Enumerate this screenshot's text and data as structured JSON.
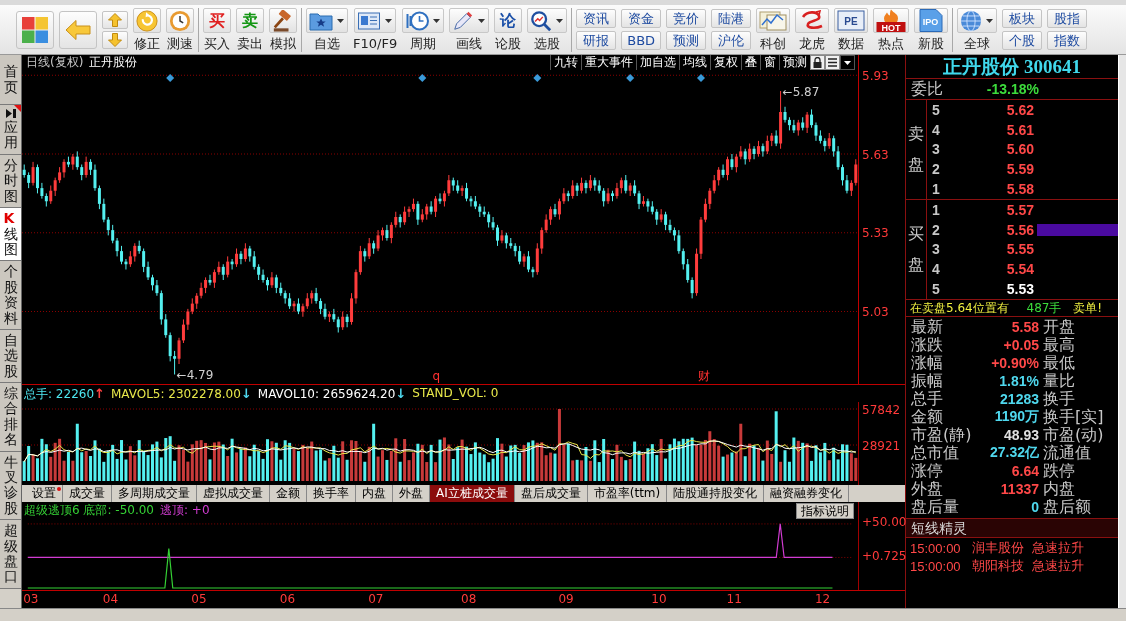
{
  "toolbar": [
    {
      "items": [
        {
          "kind": "launcher"
        },
        {
          "kind": "back"
        },
        {
          "kind": "updown"
        },
        {
          "kind": "tool",
          "label": "修正",
          "dropdown": false
        },
        {
          "kind": "tool",
          "label": "测速",
          "dropdown": false
        }
      ]
    },
    {
      "items": [
        {
          "kind": "tool",
          "label": "买入",
          "glyph": "买",
          "dropdown": false
        },
        {
          "kind": "tool",
          "label": "卖出",
          "glyph": "卖",
          "dropdown": false
        },
        {
          "kind": "tool",
          "label": "模拟",
          "dropdown": false
        }
      ]
    },
    {
      "items": [
        {
          "kind": "tool",
          "label": "自选",
          "dropdown": true
        },
        {
          "kind": "tool",
          "label": "F10/F9",
          "dropdown": true
        },
        {
          "kind": "tool",
          "label": "周期",
          "dropdown": true
        },
        {
          "kind": "tool",
          "label": "画线",
          "dropdown": true
        },
        {
          "kind": "tool",
          "label": "论股",
          "glyph": "论",
          "dropdown": false
        },
        {
          "kind": "tool",
          "label": "选股",
          "dropdown": true
        }
      ]
    },
    {
      "items": [
        {
          "kind": "pair",
          "top": "资讯",
          "bottom": "研报"
        },
        {
          "kind": "pair",
          "top": "资金",
          "bottom": "BBD"
        },
        {
          "kind": "pair",
          "top": "竞价",
          "bottom": "预测"
        },
        {
          "kind": "pair",
          "top": "陆港",
          "bottom": "沪伦"
        },
        {
          "kind": "tool",
          "label": "科创",
          "dropdown": false
        },
        {
          "kind": "tool",
          "label": "龙虎",
          "dropdown": false
        },
        {
          "kind": "tool",
          "label": "数据",
          "glyph": "PE",
          "dropdown": false
        },
        {
          "kind": "tool",
          "label": "热点",
          "glyph": "HOT",
          "dropdown": false
        },
        {
          "kind": "tool",
          "label": "新股",
          "glyph": "IPO",
          "dropdown": false
        }
      ]
    },
    {
      "items": [
        {
          "kind": "tool",
          "label": "全球",
          "dropdown": true
        },
        {
          "kind": "pair",
          "top": "板块",
          "bottom": "个股"
        },
        {
          "kind": "pair",
          "top": "股指",
          "bottom": "指数"
        }
      ]
    }
  ],
  "sidebar": [
    {
      "label": "首页",
      "kind": "plain",
      "badge": false,
      "selected": false
    },
    {
      "label": "应用",
      "kind": "icon",
      "badge": true,
      "selected": false
    },
    {
      "label": "分时图",
      "kind": "plain",
      "badge": false,
      "selected": false
    },
    {
      "label": "K线图",
      "kind": "plain",
      "badge": false,
      "selected": true
    },
    {
      "label": "个股资料",
      "kind": "plain",
      "badge": false,
      "selected": false
    },
    {
      "label": "自选股",
      "kind": "plain",
      "badge": false,
      "selected": false
    },
    {
      "label": "综合排名",
      "kind": "plain",
      "badge": false,
      "selected": false
    },
    {
      "label": "牛叉诊股",
      "kind": "plain",
      "badge": false,
      "selected": false
    },
    {
      "label": "超级盘口",
      "kind": "plain",
      "badge": false,
      "selected": false
    }
  ],
  "main_chart": {
    "period": "日线(复权)",
    "name": "正丹股份",
    "tools": [
      "九转",
      "重大事件",
      "加自选",
      "均线",
      "复权",
      "叠",
      "窗",
      "预测"
    ],
    "markers": [
      "q",
      "财"
    ],
    "chart_data": {
      "type": "candlestick",
      "ylim": [
        4.75,
        5.95
      ],
      "yticks": [
        5.93,
        5.63,
        5.33,
        5.03
      ],
      "grid": true,
      "categories": [
        null,
        null,
        null,
        null,
        null,
        null,
        null,
        null,
        null,
        null,
        null,
        null,
        null,
        null,
        null,
        null,
        null,
        null,
        null,
        null,
        null,
        null,
        null,
        null,
        null,
        null,
        null,
        null,
        null,
        null,
        null,
        null,
        null,
        null,
        null,
        null,
        null,
        null,
        null,
        null,
        null,
        null,
        null,
        null,
        null,
        null,
        null,
        null,
        null,
        null,
        null,
        null,
        null,
        null,
        null,
        null,
        null,
        null,
        null,
        null,
        null,
        null,
        null,
        null,
        null,
        null,
        null,
        null,
        null,
        null,
        null,
        null,
        null,
        null,
        null,
        null,
        null,
        null,
        null,
        null,
        null,
        null,
        null,
        null,
        null,
        null,
        null,
        null,
        null,
        null,
        null,
        null,
        null,
        null,
        null,
        null,
        null,
        null,
        null,
        null,
        null,
        null,
        null,
        null,
        null,
        null,
        null,
        null,
        null,
        null,
        null,
        null,
        null,
        null,
        null,
        null,
        null,
        null,
        null,
        null,
        null,
        null,
        null,
        null,
        null,
        null,
        null,
        null,
        null,
        null,
        null,
        null,
        null,
        null,
        null,
        null,
        null,
        null,
        null,
        null,
        null,
        null,
        null,
        null,
        null,
        null,
        null,
        null,
        null,
        null,
        null,
        null,
        null,
        null,
        null,
        null,
        null,
        null,
        null,
        null,
        null,
        null,
        null,
        null,
        null,
        null,
        null,
        null,
        null,
        null,
        null,
        null,
        null,
        null,
        null,
        null,
        null,
        null,
        null,
        null,
        null,
        null,
        null,
        null,
        null,
        null,
        null,
        null,
        null
      ],
      "ohlc": [
        [
          5.57,
          5.59,
          5.54,
          5.55
        ],
        [
          5.55,
          5.56,
          5.5,
          5.52
        ],
        [
          5.52,
          5.6,
          5.51,
          5.58
        ],
        [
          5.58,
          5.59,
          5.48,
          5.5
        ],
        [
          5.5,
          5.52,
          5.46,
          5.47
        ],
        [
          5.47,
          5.48,
          5.43,
          5.45
        ],
        [
          5.45,
          5.51,
          5.44,
          5.49
        ],
        [
          5.49,
          5.54,
          5.47,
          5.53
        ],
        [
          5.53,
          5.58,
          5.52,
          5.56
        ],
        [
          5.56,
          5.61,
          5.54,
          5.6
        ],
        [
          5.6,
          5.62,
          5.58,
          5.59
        ],
        [
          5.59,
          5.63,
          5.57,
          5.62
        ],
        [
          5.62,
          5.64,
          5.57,
          5.58
        ],
        [
          5.58,
          5.59,
          5.53,
          5.55
        ],
        [
          5.55,
          5.62,
          5.54,
          5.6
        ],
        [
          5.6,
          5.61,
          5.55,
          5.57
        ],
        [
          5.57,
          5.59,
          5.49,
          5.5
        ],
        [
          5.5,
          5.51,
          5.42,
          5.44
        ],
        [
          5.44,
          5.46,
          5.37,
          5.38
        ],
        [
          5.38,
          5.39,
          5.32,
          5.34
        ],
        [
          5.34,
          5.36,
          5.29,
          5.3
        ],
        [
          5.3,
          5.31,
          5.24,
          5.26
        ],
        [
          5.26,
          5.28,
          5.21,
          5.22
        ],
        [
          5.22,
          5.23,
          5.19,
          5.21
        ],
        [
          5.21,
          5.26,
          5.2,
          5.24
        ],
        [
          5.24,
          5.29,
          5.22,
          5.28
        ],
        [
          5.28,
          5.3,
          5.25,
          5.26
        ],
        [
          5.26,
          5.27,
          5.18,
          5.2
        ],
        [
          5.2,
          5.22,
          5.15,
          5.16
        ],
        [
          5.16,
          5.17,
          5.11,
          5.13
        ],
        [
          5.13,
          5.15,
          5.09,
          5.1
        ],
        [
          5.1,
          5.11,
          4.98,
          5.0
        ],
        [
          5.0,
          5.02,
          4.93,
          4.94
        ],
        [
          4.94,
          4.95,
          4.84,
          4.86
        ],
        [
          4.86,
          4.88,
          4.79,
          4.85
        ],
        [
          4.85,
          4.93,
          4.83,
          4.92
        ],
        [
          4.92,
          5.0,
          4.91,
          4.98
        ],
        [
          4.98,
          5.04,
          4.96,
          5.03
        ],
        [
          5.03,
          5.08,
          5.02,
          5.06
        ],
        [
          5.06,
          5.1,
          5.04,
          5.09
        ],
        [
          5.09,
          5.14,
          5.08,
          5.12
        ],
        [
          5.12,
          5.16,
          5.1,
          5.15
        ],
        [
          5.15,
          5.17,
          5.13,
          5.14
        ],
        [
          5.14,
          5.19,
          5.12,
          5.18
        ],
        [
          5.18,
          5.22,
          5.17,
          5.2
        ],
        [
          5.2,
          5.21,
          5.15,
          5.17
        ],
        [
          5.17,
          5.24,
          5.16,
          5.22
        ],
        [
          5.22,
          5.23,
          5.19,
          5.21
        ],
        [
          5.21,
          5.27,
          5.2,
          5.25
        ],
        [
          5.25,
          5.26,
          5.21,
          5.23
        ],
        [
          5.23,
          5.29,
          5.22,
          5.27
        ],
        [
          5.27,
          5.28,
          5.22,
          5.24
        ],
        [
          5.24,
          5.26,
          5.19,
          5.2
        ],
        [
          5.2,
          5.21,
          5.15,
          5.17
        ],
        [
          5.17,
          5.19,
          5.14,
          5.15
        ],
        [
          5.15,
          5.16,
          5.11,
          5.13
        ],
        [
          5.13,
          5.18,
          5.12,
          5.16
        ],
        [
          5.16,
          5.17,
          5.1,
          5.12
        ],
        [
          5.12,
          5.14,
          5.09,
          5.1
        ],
        [
          5.1,
          5.11,
          5.06,
          5.08
        ],
        [
          5.08,
          5.1,
          5.04,
          5.05
        ],
        [
          5.05,
          5.07,
          5.03,
          5.06
        ],
        [
          5.06,
          5.08,
          5.02,
          5.03
        ],
        [
          5.03,
          5.06,
          5.01,
          5.05
        ],
        [
          5.05,
          5.1,
          5.04,
          5.08
        ],
        [
          5.08,
          5.11,
          5.06,
          5.1
        ],
        [
          5.1,
          5.12,
          5.06,
          5.07
        ],
        [
          5.07,
          5.08,
          5.02,
          5.04
        ],
        [
          5.04,
          5.06,
          5.0,
          5.01
        ],
        [
          5.01,
          5.03,
          4.99,
          5.02
        ],
        [
          5.02,
          5.04,
          4.99,
          5.0
        ],
        [
          5.0,
          5.01,
          4.95,
          4.97
        ],
        [
          4.97,
          5.03,
          4.96,
          5.01
        ],
        [
          5.01,
          5.02,
          4.97,
          4.99
        ],
        [
          4.99,
          5.1,
          4.98,
          5.08
        ],
        [
          5.08,
          5.19,
          5.06,
          5.18
        ],
        [
          5.18,
          5.28,
          5.17,
          5.26
        ],
        [
          5.26,
          5.27,
          5.22,
          5.24
        ],
        [
          5.24,
          5.31,
          5.23,
          5.29
        ],
        [
          5.29,
          5.3,
          5.25,
          5.27
        ],
        [
          5.27,
          5.34,
          5.26,
          5.32
        ],
        [
          5.32,
          5.35,
          5.3,
          5.34
        ],
        [
          5.34,
          5.36,
          5.3,
          5.31
        ],
        [
          5.31,
          5.37,
          5.29,
          5.36
        ],
        [
          5.36,
          5.41,
          5.35,
          5.39
        ],
        [
          5.39,
          5.4,
          5.35,
          5.37
        ],
        [
          5.37,
          5.43,
          5.36,
          5.41
        ],
        [
          5.41,
          5.43,
          5.39,
          5.42
        ],
        [
          5.42,
          5.46,
          5.41,
          5.44
        ],
        [
          5.44,
          5.45,
          5.36,
          5.38
        ],
        [
          5.38,
          5.42,
          5.37,
          5.4
        ],
        [
          5.4,
          5.44,
          5.38,
          5.43
        ],
        [
          5.43,
          5.45,
          5.4,
          5.41
        ],
        [
          5.41,
          5.47,
          5.39,
          5.46
        ],
        [
          5.46,
          5.48,
          5.44,
          5.45
        ],
        [
          5.45,
          5.49,
          5.43,
          5.48
        ],
        [
          5.48,
          5.55,
          5.47,
          5.53
        ],
        [
          5.53,
          5.54,
          5.49,
          5.51
        ],
        [
          5.51,
          5.53,
          5.48,
          5.49
        ],
        [
          5.49,
          5.51,
          5.47,
          5.5
        ],
        [
          5.5,
          5.52,
          5.45,
          5.46
        ],
        [
          5.46,
          5.47,
          5.43,
          5.45
        ],
        [
          5.45,
          5.47,
          5.42,
          5.43
        ],
        [
          5.43,
          5.44,
          5.39,
          5.41
        ],
        [
          5.41,
          5.43,
          5.39,
          5.4
        ],
        [
          5.4,
          5.41,
          5.35,
          5.37
        ],
        [
          5.37,
          5.39,
          5.34,
          5.35
        ],
        [
          5.35,
          5.36,
          5.28,
          5.3
        ],
        [
          5.3,
          5.34,
          5.29,
          5.32
        ],
        [
          5.32,
          5.33,
          5.27,
          5.29
        ],
        [
          5.29,
          5.31,
          5.27,
          5.28
        ],
        [
          5.28,
          5.29,
          5.24,
          5.26
        ],
        [
          5.26,
          5.28,
          5.21,
          5.22
        ],
        [
          5.22,
          5.25,
          5.2,
          5.24
        ],
        [
          5.24,
          5.26,
          5.18,
          5.19
        ],
        [
          5.19,
          5.2,
          5.16,
          5.18
        ],
        [
          5.18,
          5.29,
          5.17,
          5.27
        ],
        [
          5.27,
          5.35,
          5.25,
          5.34
        ],
        [
          5.34,
          5.4,
          5.33,
          5.38
        ],
        [
          5.38,
          5.43,
          5.36,
          5.42
        ],
        [
          5.42,
          5.44,
          5.39,
          5.4
        ],
        [
          5.4,
          5.46,
          5.38,
          5.45
        ],
        [
          5.45,
          5.5,
          5.44,
          5.48
        ],
        [
          5.48,
          5.49,
          5.45,
          5.47
        ],
        [
          5.47,
          5.53,
          5.46,
          5.51
        ],
        [
          5.51,
          5.52,
          5.47,
          5.49
        ],
        [
          5.49,
          5.54,
          5.48,
          5.52
        ],
        [
          5.52,
          5.53,
          5.48,
          5.5
        ],
        [
          5.5,
          5.55,
          5.49,
          5.53
        ],
        [
          5.53,
          5.54,
          5.49,
          5.51
        ],
        [
          5.51,
          5.53,
          5.48,
          5.49
        ],
        [
          5.49,
          5.5,
          5.43,
          5.45
        ],
        [
          5.45,
          5.5,
          5.44,
          5.48
        ],
        [
          5.48,
          5.49,
          5.45,
          5.47
        ],
        [
          5.47,
          5.52,
          5.46,
          5.5
        ],
        [
          5.5,
          5.54,
          5.48,
          5.53
        ],
        [
          5.53,
          5.55,
          5.48,
          5.49
        ],
        [
          5.49,
          5.52,
          5.47,
          5.51
        ],
        [
          5.51,
          5.53,
          5.47,
          5.48
        ],
        [
          5.48,
          5.49,
          5.42,
          5.44
        ],
        [
          5.44,
          5.47,
          5.43,
          5.45
        ],
        [
          5.45,
          5.46,
          5.41,
          5.43
        ],
        [
          5.43,
          5.45,
          5.4,
          5.41
        ],
        [
          5.41,
          5.42,
          5.36,
          5.38
        ],
        [
          5.38,
          5.42,
          5.37,
          5.4
        ],
        [
          5.4,
          5.41,
          5.34,
          5.36
        ],
        [
          5.36,
          5.38,
          5.33,
          5.34
        ],
        [
          5.34,
          5.35,
          5.3,
          5.32
        ],
        [
          5.32,
          5.34,
          5.25,
          5.26
        ],
        [
          5.26,
          5.27,
          5.19,
          5.21
        ],
        [
          5.21,
          5.23,
          5.14,
          5.15
        ],
        [
          5.15,
          5.16,
          5.08,
          5.1
        ],
        [
          5.1,
          5.27,
          5.09,
          5.25
        ],
        [
          5.25,
          5.39,
          5.23,
          5.38
        ],
        [
          5.38,
          5.46,
          5.37,
          5.44
        ],
        [
          5.44,
          5.5,
          5.42,
          5.49
        ],
        [
          5.49,
          5.55,
          5.48,
          5.53
        ],
        [
          5.53,
          5.58,
          5.51,
          5.57
        ],
        [
          5.57,
          5.59,
          5.54,
          5.55
        ],
        [
          5.55,
          5.62,
          5.53,
          5.61
        ],
        [
          5.61,
          5.63,
          5.57,
          5.58
        ],
        [
          5.58,
          5.63,
          5.56,
          5.62
        ],
        [
          5.62,
          5.66,
          5.61,
          5.64
        ],
        [
          5.64,
          5.65,
          5.59,
          5.61
        ],
        [
          5.61,
          5.67,
          5.6,
          5.65
        ],
        [
          5.65,
          5.66,
          5.61,
          5.63
        ],
        [
          5.63,
          5.68,
          5.62,
          5.66
        ],
        [
          5.66,
          5.67,
          5.62,
          5.64
        ],
        [
          5.64,
          5.7,
          5.63,
          5.68
        ],
        [
          5.68,
          5.71,
          5.66,
          5.7
        ],
        [
          5.7,
          5.72,
          5.66,
          5.67
        ],
        [
          5.67,
          5.87,
          5.65,
          5.79
        ],
        [
          5.79,
          5.81,
          5.75,
          5.76
        ],
        [
          5.76,
          5.77,
          5.72,
          5.74
        ],
        [
          5.74,
          5.76,
          5.71,
          5.72
        ],
        [
          5.72,
          5.76,
          5.7,
          5.75
        ],
        [
          5.75,
          5.77,
          5.72,
          5.73
        ],
        [
          5.73,
          5.79,
          5.71,
          5.78
        ],
        [
          5.78,
          5.8,
          5.73,
          5.74
        ],
        [
          5.74,
          5.75,
          5.68,
          5.7
        ],
        [
          5.7,
          5.72,
          5.67,
          5.68
        ],
        [
          5.68,
          5.69,
          5.64,
          5.66
        ],
        [
          5.66,
          5.71,
          5.65,
          5.69
        ],
        [
          5.69,
          5.7,
          5.62,
          5.64
        ],
        [
          5.64,
          5.66,
          5.57,
          5.58
        ],
        [
          5.58,
          5.59,
          5.51,
          5.53
        ],
        [
          5.53,
          5.55,
          5.48,
          5.49
        ],
        [
          5.49,
          5.53,
          5.47,
          5.52
        ],
        [
          5.52,
          5.61,
          5.51,
          5.59
        ]
      ],
      "annotations": [
        "←5.87",
        "←4.79"
      ]
    }
  },
  "volume_panel": {
    "legend": [
      {
        "text": "总手: 22260",
        "color": "#4ee6f0",
        "arrow": {
          "text": "↑",
          "color": "#ff4040"
        }
      },
      {
        "text": "MAVOL5: 2302278.00",
        "color": "#e8e84a",
        "arrow": {
          "text": "↓",
          "color": "#4fd8ee"
        }
      },
      {
        "text": "MAVOL10: 2659624.20",
        "color": "#ffffff",
        "arrow": {
          "text": "↓",
          "color": "#4fd8ee"
        }
      },
      {
        "text": "STAND_VOL: 0",
        "color": "#e8e84a"
      }
    ],
    "ticks": [
      "57842",
      "28921"
    ]
  },
  "indicator_tabs": [
    {
      "label": "设置",
      "selected": false,
      "badge": true
    },
    {
      "label": "成交量",
      "selected": false,
      "badge": false
    },
    {
      "label": "多周期成交量",
      "selected": false,
      "badge": false
    },
    {
      "label": "虚拟成交量",
      "selected": false,
      "badge": false
    },
    {
      "label": "金额",
      "selected": false,
      "badge": false
    },
    {
      "label": "换手率",
      "selected": false,
      "badge": false
    },
    {
      "label": "内盘",
      "selected": false,
      "badge": false
    },
    {
      "label": "外盘",
      "selected": false,
      "badge": false
    },
    {
      "label": "AI立桩成交量",
      "selected": true,
      "badge": false
    },
    {
      "label": "盘后成交量",
      "selected": false,
      "badge": false
    },
    {
      "label": "市盈率(ttm)",
      "selected": false,
      "badge": false
    },
    {
      "label": "陆股通持股变化",
      "selected": false,
      "badge": false
    },
    {
      "label": "融资融券变化",
      "selected": false,
      "badge": false
    }
  ],
  "indicator_panel": {
    "legend": [
      {
        "text": "超级逃顶6 底部: -50.00",
        "color": "#35d235"
      },
      {
        "text": "逃顶: +0",
        "color": "#d23cd2"
      }
    ],
    "help_button": "指标说明",
    "ticks": [
      "+50.00",
      "+0.725"
    ]
  },
  "date_axis": [
    "03",
    "04",
    "05",
    "06",
    "07",
    "08",
    "09",
    "10",
    "11",
    "12"
  ],
  "quote": {
    "title": "正丹股份 300641",
    "ratio": {
      "label": "委比",
      "value": "-13.18%",
      "color": "#3cdc3c"
    },
    "sell": {
      "label": "卖盘",
      "levels": [
        {
          "rank": "5",
          "price": "5.62",
          "color": "#ff4848",
          "selected": false
        },
        {
          "rank": "4",
          "price": "5.61",
          "color": "#ff4848",
          "selected": false
        },
        {
          "rank": "3",
          "price": "5.60",
          "color": "#ff4848",
          "selected": false
        },
        {
          "rank": "2",
          "price": "5.59",
          "color": "#ff4848",
          "selected": false
        },
        {
          "rank": "1",
          "price": "5.58",
          "color": "#ff4848",
          "selected": false
        }
      ]
    },
    "buy": {
      "label": "买盘",
      "levels": [
        {
          "rank": "1",
          "price": "5.57",
          "color": "#ff4848",
          "selected": false
        },
        {
          "rank": "2",
          "price": "5.56",
          "color": "#ff4848",
          "selected": true
        },
        {
          "rank": "3",
          "price": "5.55",
          "color": "#ff4848",
          "selected": false
        },
        {
          "rank": "4",
          "price": "5.54",
          "color": "#ff4848",
          "selected": false
        },
        {
          "rank": "5",
          "price": "5.53",
          "color": "#ffffff",
          "selected": false
        }
      ]
    },
    "alert": {
      "text": "在卖盘5.64位置有",
      "volume": "487手",
      "tail": "卖单!"
    },
    "stats": [
      {
        "label": "最新",
        "value": "5.58",
        "color": "#ff4848",
        "next_label": "开盘"
      },
      {
        "label": "涨跌",
        "value": "+0.05",
        "color": "#ff4848",
        "next_label": "最高"
      },
      {
        "label": "涨幅",
        "value": "+0.90%",
        "color": "#ff4848",
        "next_label": "最低"
      },
      {
        "label": "振幅",
        "value": "1.81%",
        "color": "#4fd8ee",
        "next_label": "量比"
      },
      {
        "label": "总手",
        "value": "21283",
        "color": "#4fd8ee",
        "next_label": "换手"
      },
      {
        "label": "金额",
        "value": "1190万",
        "color": "#4fd8ee",
        "next_label": "换手[实]"
      },
      {
        "label": "市盈(静)",
        "value": "48.93",
        "color": "#e0e0e0",
        "next_label": "市盈(动)"
      },
      {
        "label": "总市值",
        "value": "27.32亿",
        "color": "#4fd8ee",
        "next_label": "流通值"
      },
      {
        "label": "涨停",
        "value": "6.64",
        "color": "#ff4848",
        "next_label": "跌停"
      },
      {
        "label": "外盘",
        "value": "11337",
        "color": "#ff4848",
        "next_label": "内盘"
      },
      {
        "label": "盘后量",
        "value": "0",
        "color": "#4fd8ee",
        "next_label": "盘后额"
      }
    ]
  },
  "short_term_alerts": {
    "title": "短线精灵",
    "rows": [
      {
        "time": "15:00:00",
        "stock": "润丰股份",
        "event": "急速拉升",
        "color": "#ff4848"
      },
      {
        "time": "15:00:00",
        "stock": "朝阳科技",
        "event": "急速拉升",
        "color": "#ff4848"
      }
    ]
  }
}
